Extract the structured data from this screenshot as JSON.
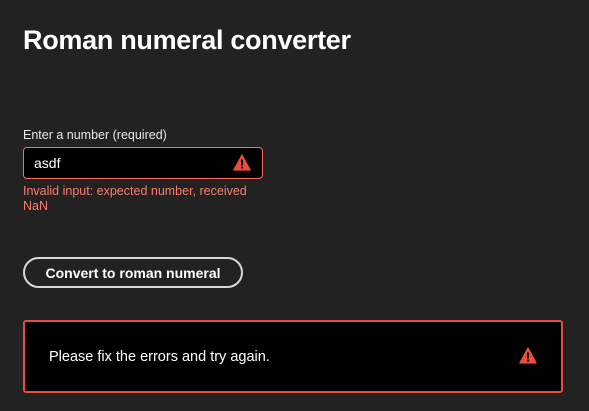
{
  "page": {
    "title": "Roman numeral converter"
  },
  "form": {
    "number_label": "Enter a number (required)",
    "number_value": "asdf",
    "error_message": "Invalid input: expected number, received NaN",
    "submit_label": "Convert to roman numeral"
  },
  "banner": {
    "message": "Please fix the errors and try again.",
    "icon": "warning-icon"
  },
  "colors": {
    "background": "#222222",
    "input_background": "#000000",
    "error_border": "#ff6b5c",
    "error_text": "#ff7d6b",
    "banner_border": "#ea4c3d",
    "warning_icon": "#ea4c3d"
  }
}
